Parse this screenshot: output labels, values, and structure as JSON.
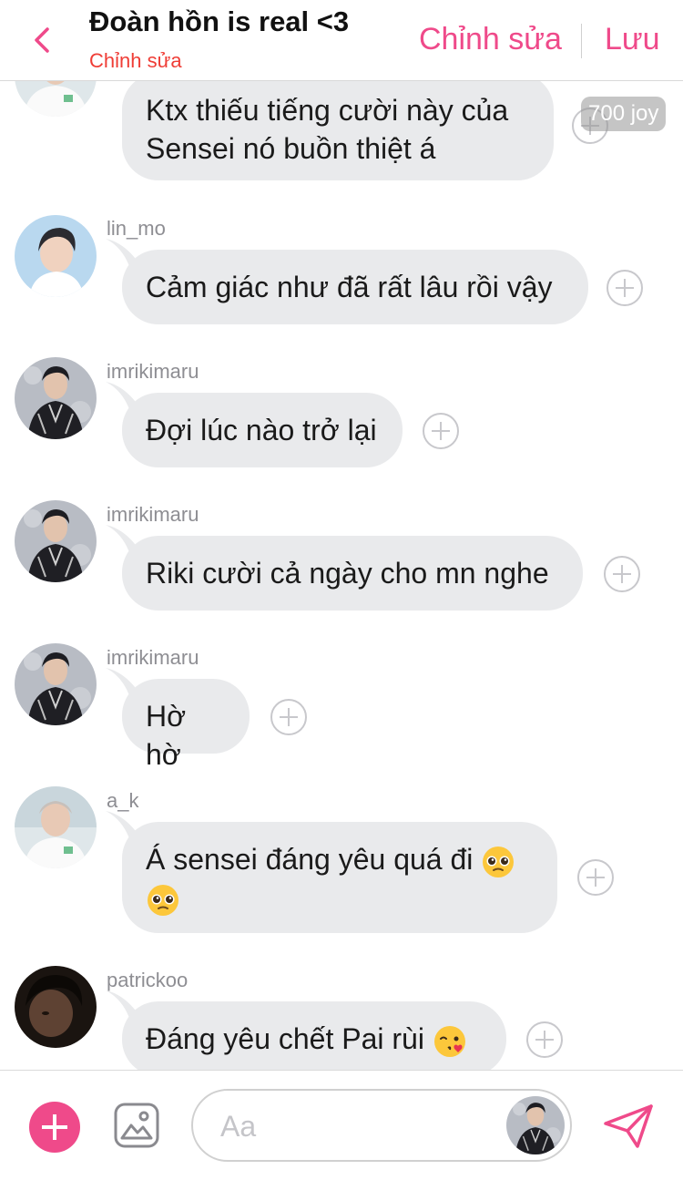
{
  "header": {
    "title": "Đoàn hồn is real <3",
    "subtitle": "Chỉnh sửa",
    "edit_label": "Chỉnh sửa",
    "save_label": "Lưu"
  },
  "joy_badge": "700 joy",
  "messages": [
    {
      "username": "",
      "text": "Ktx thiếu tiếng cười này của Sensei nó buồn thiệt á",
      "avatar": "white-shirt-boy"
    },
    {
      "username": "lin_mo",
      "text": "Cảm giác như đã rất lâu rồi vậy",
      "avatar": "blue-sky-boy"
    },
    {
      "username": "imrikimaru",
      "text": "Đợi lúc nào trở lại",
      "avatar": "black-jacket-boy"
    },
    {
      "username": "imrikimaru",
      "text": "Riki cười cả ngày cho mn nghe",
      "avatar": "black-jacket-boy"
    },
    {
      "username": "imrikimaru",
      "text": "Hờ hờ",
      "avatar": "black-jacket-boy"
    },
    {
      "username": "a_k",
      "text_line1": "Á sensei đáng yêu quá đi",
      "emoji": "pleading-face",
      "avatar": "white-shirt-boy"
    },
    {
      "username": "patrickoo",
      "text": "Đáng yêu chết Pai rùi",
      "emoji": "face-blowing-kiss",
      "avatar": "dark-portrait-boy"
    }
  ],
  "composer": {
    "placeholder": "Aa"
  },
  "colors": {
    "accent": "#ef4a8a",
    "subtitle": "#ef3d36",
    "bubble": "#e9eaec",
    "username": "#8e8e93"
  }
}
